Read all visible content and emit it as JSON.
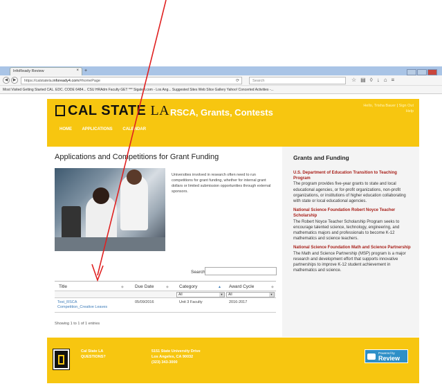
{
  "browser": {
    "tab_title": "InfoReady Review",
    "tab_close": "×",
    "new_tab": "+",
    "url_prefix": "https://calstatela.",
    "url_host": "infoready4.com",
    "url_path": "/#homePage",
    "search_placeholder": "Search",
    "bookmarks": "Most Visited   Getting Started   CAL. EDC. CODE 6484...   CSU HRAdm Faculty   GET *** Sigalert.com - Los Ang...   Suggested Sites   Web Slice Gallery   Yahoo!   Concerted Activities -..."
  },
  "header": {
    "logo_cal": "CAL STATE",
    "logo_la": "LA",
    "site_title": "RSCA, Grants, Contests",
    "hello_label": "Hello,",
    "hello_user": "Trisha Bauer",
    "sign_out": "Sign Out",
    "help": "Help",
    "menu": [
      "HOME",
      "APPLICATIONS",
      "CALENDAR"
    ]
  },
  "main": {
    "title": "Applications and Competitions for Grant Funding",
    "intro": "Universities involved in research often need to run competitions for grant funding, whether for internal grant dollars or limited submission opportunities through external sponsors.",
    "search_label": "Search:",
    "table": {
      "columns": [
        "Title",
        "Due Date",
        "Category",
        "Award Cycle"
      ],
      "filters": [
        "All",
        "All"
      ],
      "rows": [
        {
          "title": "Test_RSCA Competition_Creative Leaves",
          "due_date": "05/09/2016",
          "category": "Unit 3 Faculty",
          "award_cycle": "2016-2017"
        }
      ]
    },
    "showing": "Showing 1 to 1 of 1 entries"
  },
  "sidebar": {
    "title": "Grants and Funding",
    "items": [
      {
        "title": "U.S. Department of Education Transition to Teaching Program",
        "desc": "The program provides five-year grants to state and local educational agencies, or for-profit organizations, non-profit organizations, or institutions of higher education collaborating with state or local educational agencies."
      },
      {
        "title": "National Science Foundation Robert Noyce Teacher Scholarship",
        "desc": "The Robert Noyce Teacher Scholarship Program seeks to encourage talented science, technology, engineering, and mathematics majors and professionals to become K-12 mathematics and science teachers."
      },
      {
        "title": "National Science Foundation Math and Science Partnership",
        "desc": "The Math and Science Partnership (MSP) program is a major research and development effort that supports innovative partnerships to improve K-12 student achievement in mathematics and science."
      }
    ]
  },
  "footer": {
    "col1": [
      "Cal State LA",
      "QUESTIONS?"
    ],
    "col2": [
      "5151 State University Drive",
      "Los Angeles, CA 90032",
      "(323) 343-3000"
    ],
    "badge_small": "Powered by",
    "badge_big": "Review"
  },
  "colors": {
    "brand_gold": "#f7c610",
    "annotation_arrow": "#e02020"
  }
}
